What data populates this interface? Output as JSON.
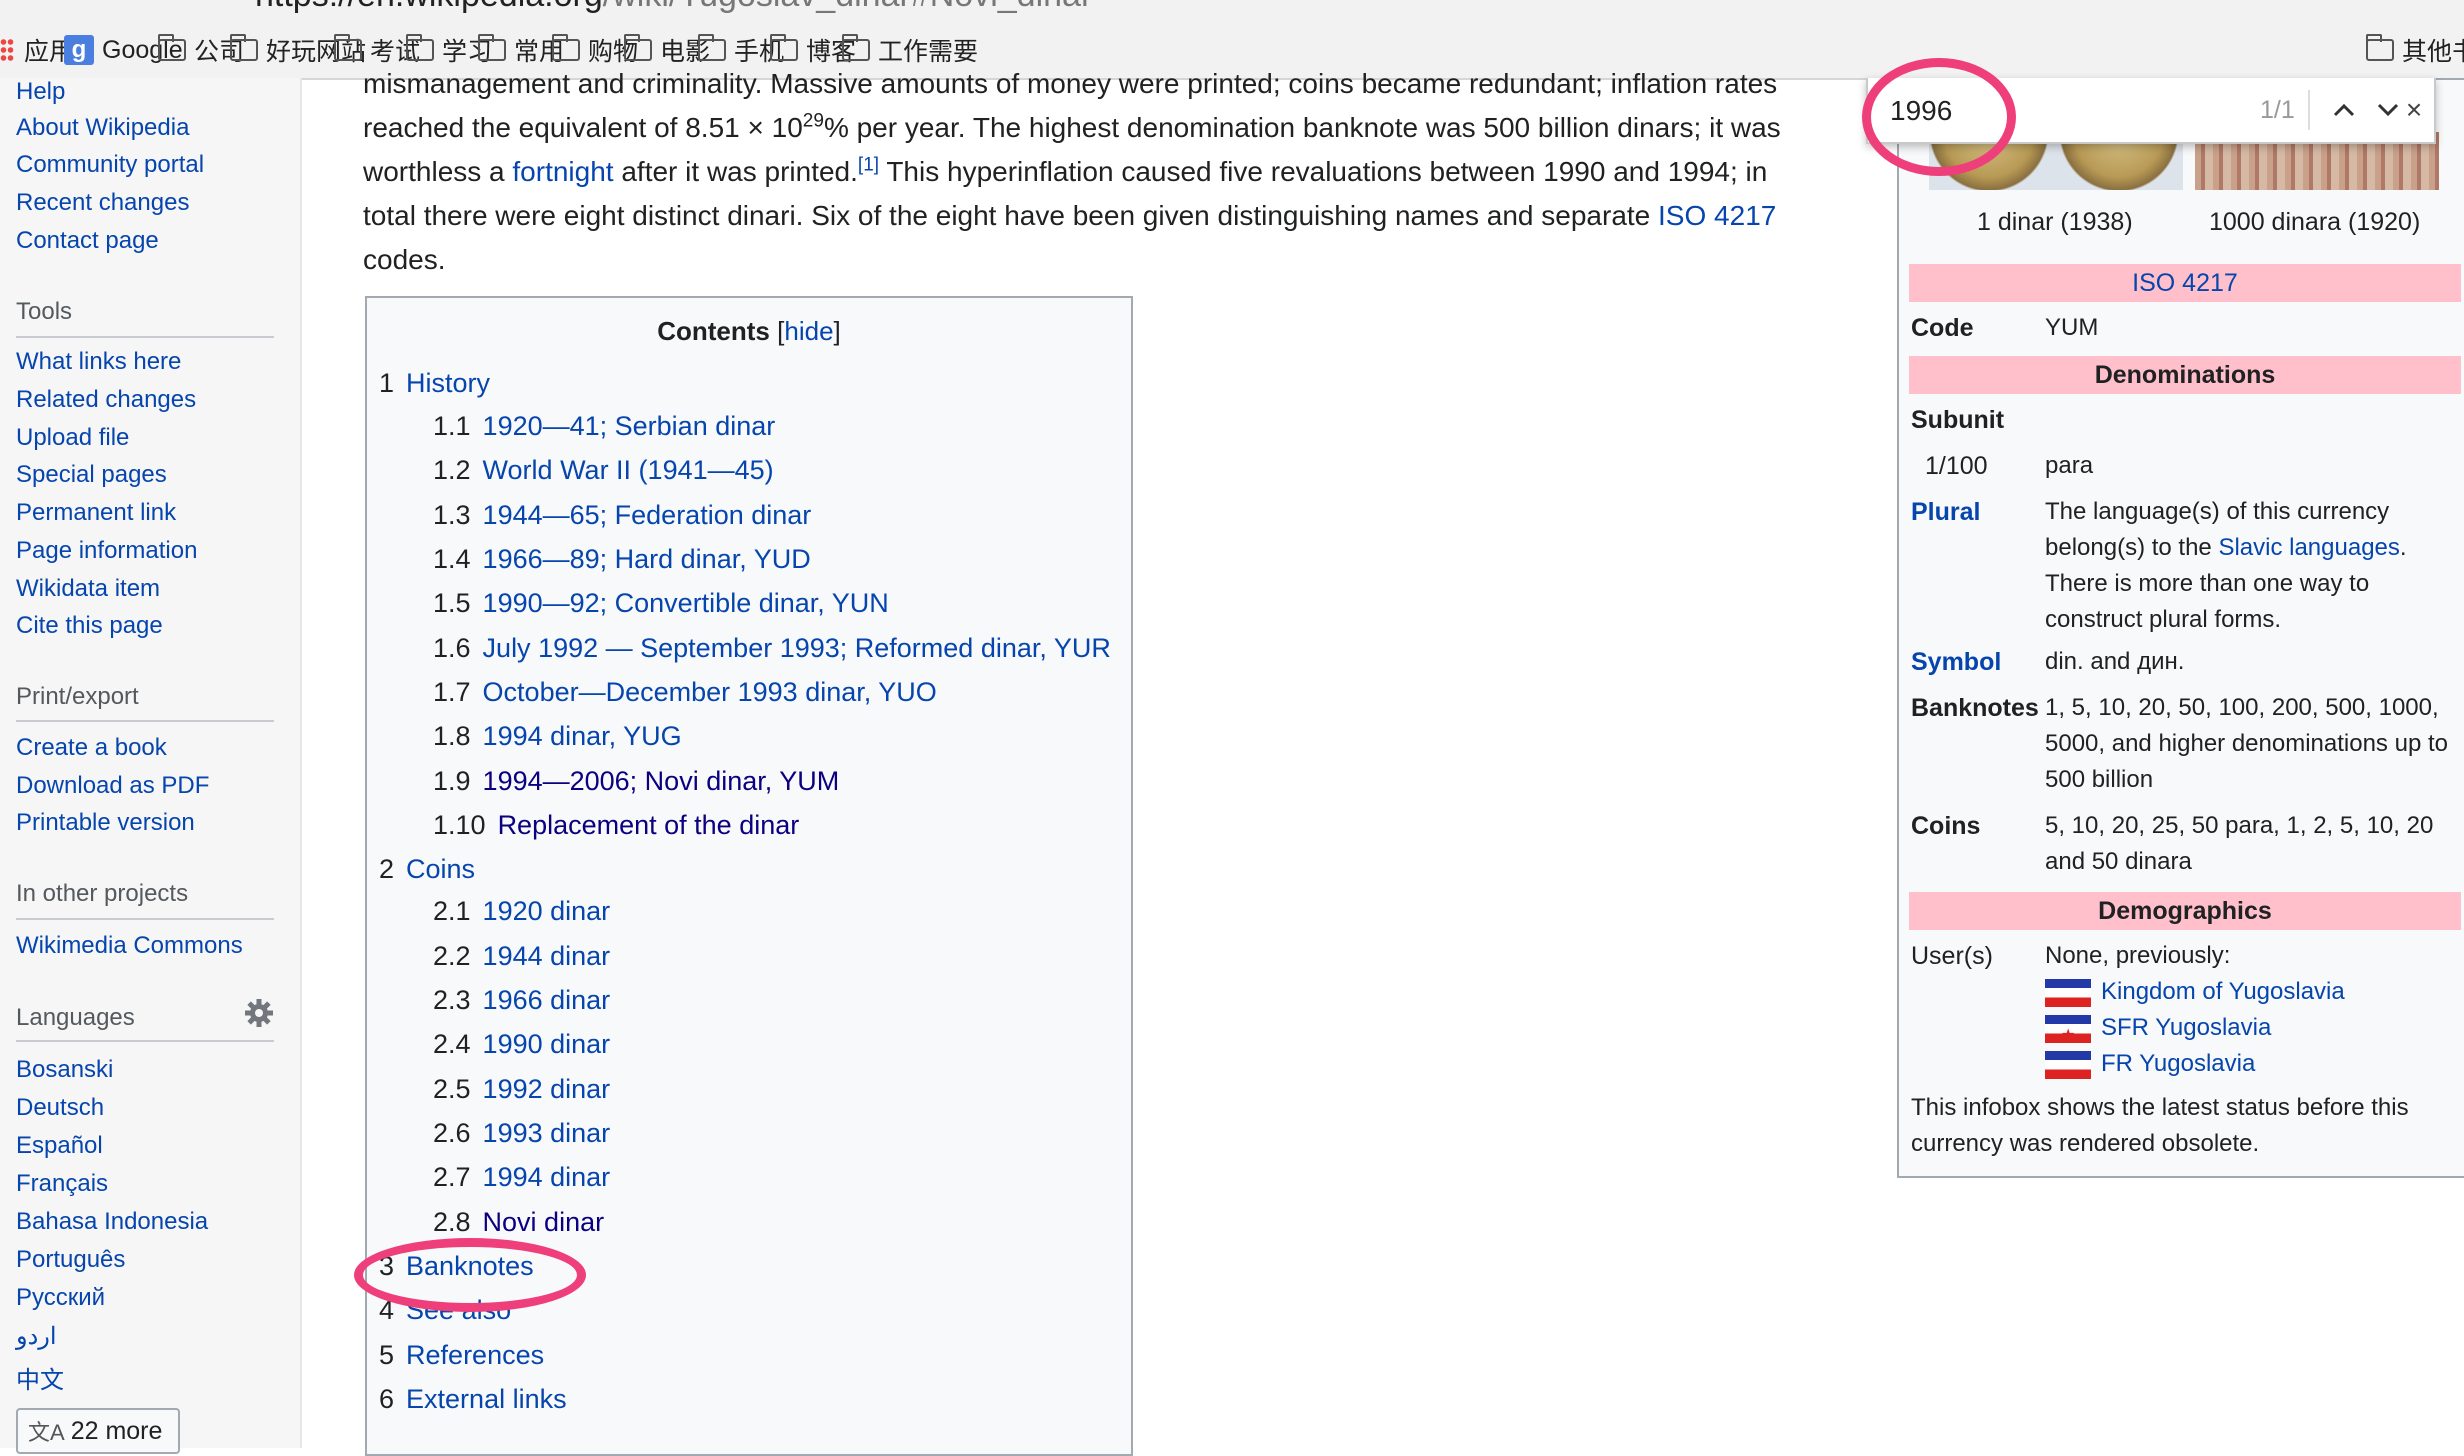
{
  "browser": {
    "url_host": "https://en.wikipedia.org",
    "url_path": "/wiki/Yugoslav_dinar#Novi_dinar",
    "bookmarks": [
      "应用",
      "Google",
      "公司",
      "好玩网站",
      "考试",
      "学习",
      "常用",
      "购物",
      "电影",
      "手机",
      "博客",
      "工作需要",
      "其他书"
    ]
  },
  "sidebar": {
    "top_links": [
      "Help",
      "About Wikipedia",
      "Community portal",
      "Recent changes",
      "Contact page"
    ],
    "tools_heading": "Tools",
    "tools": [
      "What links here",
      "Related changes",
      "Upload file",
      "Special pages",
      "Permanent link",
      "Page information",
      "Wikidata item",
      "Cite this page"
    ],
    "print_heading": "Print/export",
    "print": [
      "Create a book",
      "Download as PDF",
      "Printable version"
    ],
    "other_heading": "In other projects",
    "other": [
      "Wikimedia Commons"
    ],
    "lang_heading": "Languages",
    "languages": [
      "Bosanski",
      "Deutsch",
      "Español",
      "Français",
      "Bahasa Indonesia",
      "Português",
      "Русский",
      "اردو",
      "中文"
    ],
    "more_label": "22 more",
    "settings_icon": "gear-icon"
  },
  "article": {
    "line1": "mismanagement and criminality. Massive amounts of money were printed; coins became redundant; inflation rates",
    "line2_pre": "reached the equivalent of 8.51 × 10",
    "line2_sup": "29",
    "line2_post": "% per year. The highest denomination banknote was 500 billion dinars; it was",
    "line3_pre": "worthless a ",
    "line3_link": "fortnight",
    "line3_mid": " after it was printed.",
    "line3_ref": "[1]",
    "line3_post": " This hyperinflation caused five revaluations between 1990 and 1994; in",
    "line4_pre": "total there were eight distinct dinari. Six of the eight have been given distinguishing names and separate ",
    "line4_link": "ISO 4217",
    "line5": "codes."
  },
  "toc": {
    "title": "Contents",
    "hide_label": "hide",
    "items": [
      {
        "num": "1",
        "text": "History"
      },
      {
        "num": "1.1",
        "text": "1920—41; Serbian dinar"
      },
      {
        "num": "1.2",
        "text": "World War II (1941—45)"
      },
      {
        "num": "1.3",
        "text": "1944—65; Federation dinar"
      },
      {
        "num": "1.4",
        "text": "1966—89; Hard dinar, YUD"
      },
      {
        "num": "1.5",
        "text": "1990—92; Convertible dinar, YUN"
      },
      {
        "num": "1.6",
        "text": "July 1992 — September 1993; Reformed dinar, YUR"
      },
      {
        "num": "1.7",
        "text": "October—December 1993 dinar, YUO"
      },
      {
        "num": "1.8",
        "text": "1994 dinar, YUG"
      },
      {
        "num": "1.9",
        "text": "1994—2006; Novi dinar, YUM"
      },
      {
        "num": "1.10",
        "text": "Replacement of the dinar"
      },
      {
        "num": "2",
        "text": "Coins"
      },
      {
        "num": "2.1",
        "text": "1920 dinar"
      },
      {
        "num": "2.2",
        "text": "1944 dinar"
      },
      {
        "num": "2.3",
        "text": "1966 dinar"
      },
      {
        "num": "2.4",
        "text": "1990 dinar"
      },
      {
        "num": "2.5",
        "text": "1992 dinar"
      },
      {
        "num": "2.6",
        "text": "1993 dinar"
      },
      {
        "num": "2.7",
        "text": "1994 dinar"
      },
      {
        "num": "2.8",
        "text": "Novi dinar"
      },
      {
        "num": "3",
        "text": "Banknotes"
      },
      {
        "num": "4",
        "text": "See also"
      },
      {
        "num": "5",
        "text": "References"
      },
      {
        "num": "6",
        "text": "External links"
      }
    ]
  },
  "infobox": {
    "caption_coin": "1 dinar (1938)",
    "caption_note": "1000 dinara (1920)",
    "iso_band": "ISO 4217",
    "code_label": "Code",
    "code_value": "YUM",
    "denom_band": "Denominations",
    "subunit_label": "Subunit",
    "subunit_fraction": "1/100",
    "subunit_name": "para",
    "plural_label": "Plural",
    "plural_pre": "The language(s) of this currency belong(s) to the ",
    "plural_link": "Slavic languages",
    "plural_post": ". There is more than one way to construct plural forms.",
    "symbol_label": "Symbol",
    "symbol_value": "din. and дин.",
    "banknotes_label": "Banknotes",
    "banknotes_value": "1, 5, 10, 20, 50, 100, 200, 500, 1000, 5000, and higher denominations up to 500 billion",
    "coins_label": "Coins",
    "coins_value": "5, 10, 20, 25, 50 para, 1, 2, 5, 10, 20 and 50 dinara",
    "demo_band": "Demographics",
    "users_label": "User(s)",
    "users_intro": "None, previously:",
    "users": [
      "Kingdom of Yugoslavia",
      "SFR Yugoslavia",
      "FR Yugoslavia"
    ],
    "footer": "This infobox shows the latest status before this currency was rendered obsolete."
  },
  "findbar": {
    "query": "1996",
    "count": "1/1",
    "close": "×"
  },
  "colors": {
    "annotation": "#ee3f7b",
    "link": "#0645ad",
    "infobox_band": "#ffc0cb"
  }
}
